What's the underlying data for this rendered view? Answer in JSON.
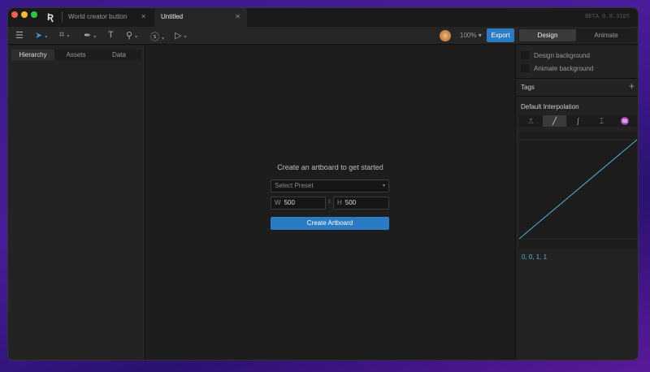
{
  "window": {
    "version": "BETA 0.8.3105"
  },
  "tabs": [
    {
      "label": "World creator button"
    },
    {
      "label": "Untitled",
      "active": true
    }
  ],
  "toolbar": {
    "zoom": "100%",
    "export_label": "Export",
    "modes": [
      "Design",
      "Animate"
    ],
    "active_mode": "Design",
    "accent": "#2a7bc4"
  },
  "left_panel": {
    "tabs": [
      "Hierarchy",
      "Assets",
      "Data"
    ],
    "active": "Hierarchy"
  },
  "canvas": {
    "prompt": "Create an artboard to get started",
    "preset_placeholder": "Select Preset",
    "width_label": "W",
    "width": "500",
    "height_label": "H",
    "height": "500",
    "create_label": "Create Artboard"
  },
  "right_panel": {
    "design_background": "Design background",
    "animate_background": "Animate background",
    "tags": "Tags",
    "interpolation_title": "Default Interpolation",
    "interpolation_options": [
      "hold",
      "linear",
      "cubic",
      "elastic",
      "bounce"
    ],
    "active_interpolation": "linear",
    "values": "0, 0, 1, 1",
    "curve_color": "#5ab0d8"
  }
}
